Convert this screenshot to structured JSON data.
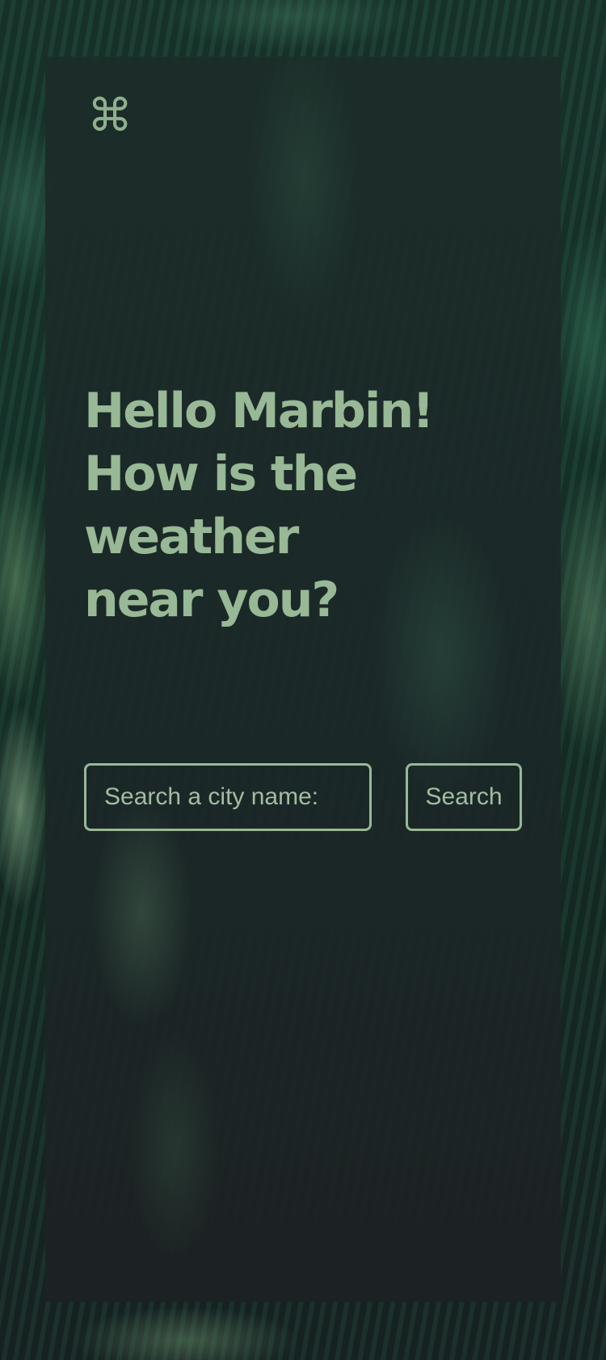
{
  "logo": {
    "glyph": "⌘",
    "icon": "command-icon"
  },
  "greeting": {
    "line1": "Hello Marbin!",
    "line2": "How is the weather",
    "line3": "near you?"
  },
  "search": {
    "placeholder": "Search a city name:",
    "value": "",
    "button_label": "Search"
  },
  "colors": {
    "accent": "#98b896",
    "panel": "#1c2b29",
    "background": "#1a3a30"
  }
}
